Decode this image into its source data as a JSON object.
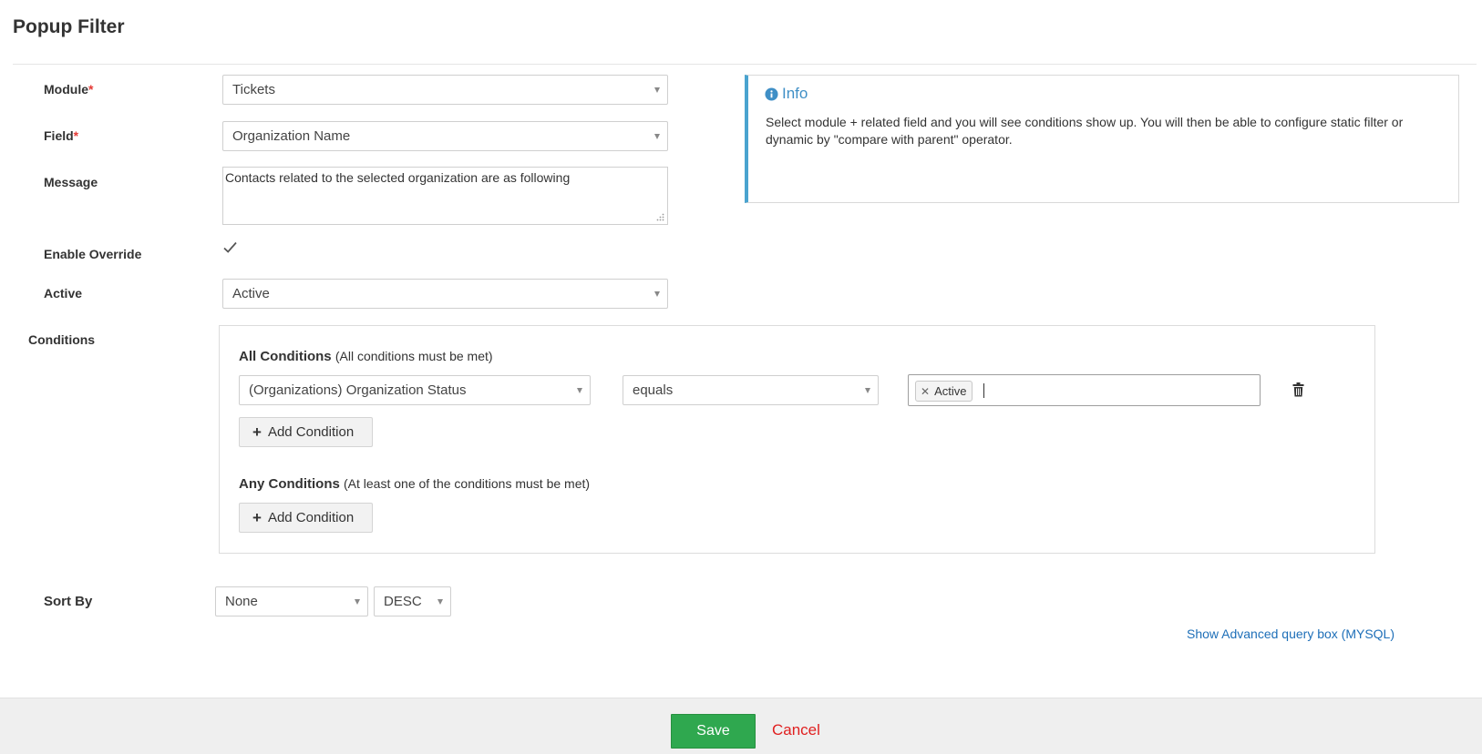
{
  "page": {
    "title": "Popup Filter"
  },
  "form": {
    "module": {
      "label": "Module",
      "required_mark": "*",
      "value": "Tickets"
    },
    "field": {
      "label": "Field",
      "required_mark": "*",
      "value": "Organization Name"
    },
    "message": {
      "label": "Message",
      "value": "Contacts related to the selected organization are as following"
    },
    "enable_override": {
      "label": "Enable Override",
      "checked": true
    },
    "active": {
      "label": "Active",
      "value": "Active"
    }
  },
  "info": {
    "title": "Info",
    "text": "Select module + related field and you will see conditions show up. You will then be able to configure static filter or dynamic by \"compare with parent\" operator."
  },
  "conditions": {
    "label": "Conditions",
    "all": {
      "heading": "All Conditions",
      "subtext": "(All conditions must be met)",
      "rows": [
        {
          "field": "(Organizations) Organization Status",
          "operator": "equals",
          "tags": [
            "Active"
          ]
        }
      ],
      "add_label": "Add Condition"
    },
    "any": {
      "heading": "Any Conditions",
      "subtext": "(At least one of the conditions must be met)",
      "add_label": "Add Condition"
    }
  },
  "sort": {
    "label": "Sort By",
    "field_value": "None",
    "direction_value": "DESC"
  },
  "advanced_link": "Show Advanced query box (MYSQL)",
  "footer": {
    "save_label": "Save",
    "cancel_label": "Cancel"
  },
  "icons": {
    "info": "info-circle-icon",
    "check": "check-icon",
    "trash": "trash-icon",
    "plus": "plus-icon",
    "caret": "caret-down-icon",
    "tag_remove": "close-icon"
  },
  "colors": {
    "info_accent": "#4aa3cf",
    "required": "#e53935",
    "save_bg": "#2fa84f",
    "cancel": "#e02020",
    "link": "#1e6fb8"
  }
}
